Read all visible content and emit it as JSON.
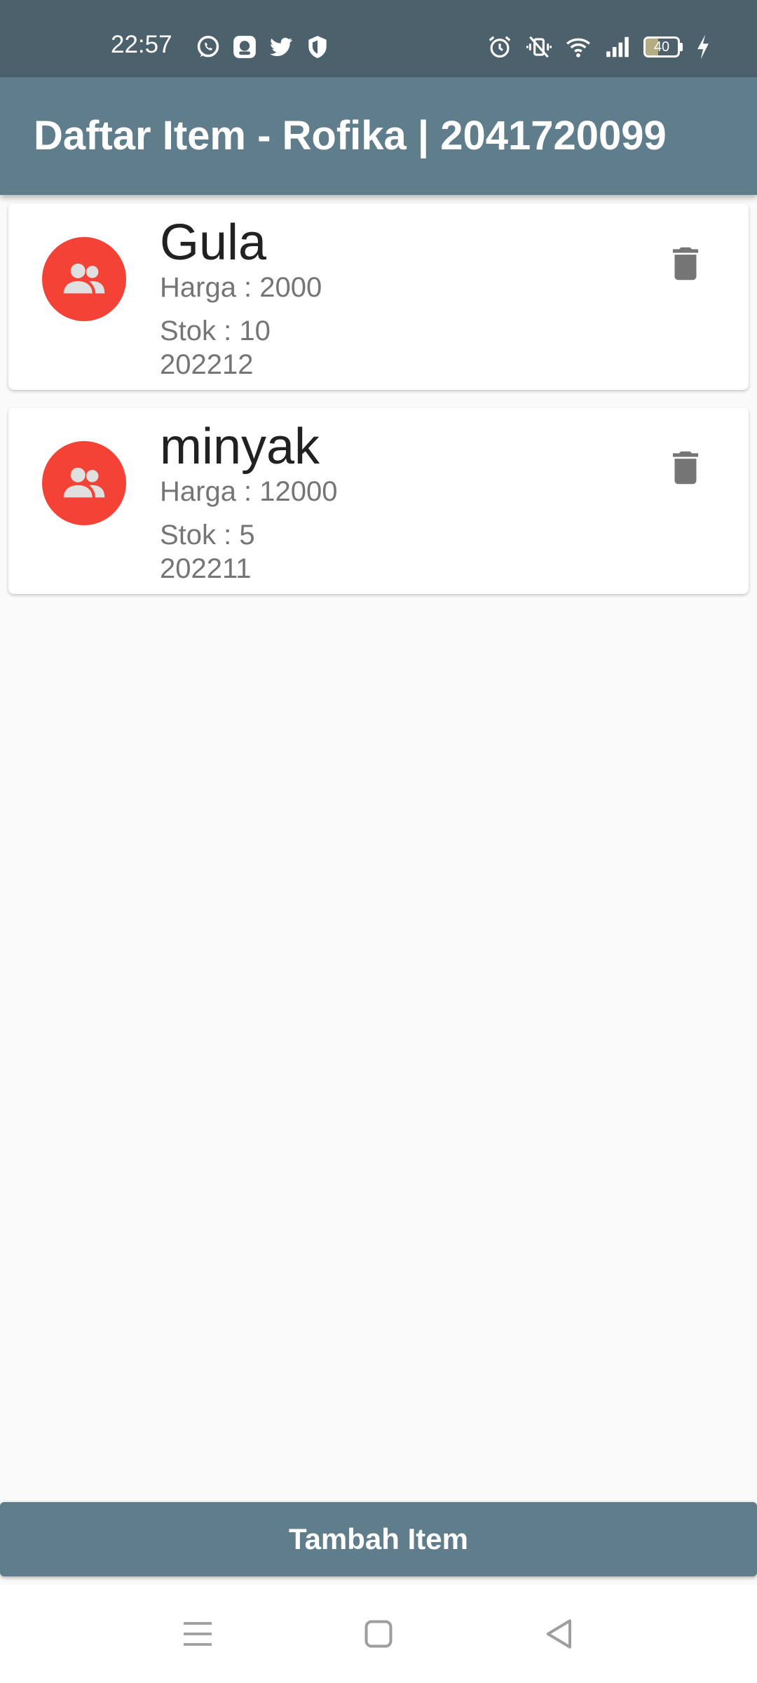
{
  "status_bar": {
    "time": "22:57",
    "left_icons": [
      "whatsapp-icon",
      "signal-app-icon",
      "twitter-icon",
      "shield-icon"
    ],
    "right_icons": [
      "alarm-icon",
      "vibrate-off-icon",
      "wifi-icon",
      "cell-signal-icon"
    ],
    "battery_level": "40",
    "battery_fraction": 0.4,
    "charging_icon": "bolt-icon"
  },
  "app_bar": {
    "title": "Daftar Item - Rofika | 2041720099"
  },
  "items": [
    {
      "name": "Gula",
      "harga": "Harga : 2000",
      "stok": "Stok : 10",
      "kode": "202212",
      "avatar_icon": "people-icon",
      "action_icon": "delete-icon"
    },
    {
      "name": "minyak",
      "harga": "Harga : 12000",
      "stok": "Stok : 5",
      "kode": "202211",
      "avatar_icon": "people-icon",
      "action_icon": "delete-icon"
    }
  ],
  "footer": {
    "add_button_label": "Tambah Item"
  },
  "nav_bar": {
    "icons": [
      "menu-icon",
      "home-square-icon",
      "back-triangle-icon"
    ]
  },
  "colors": {
    "status_bar": "#4c616c",
    "app_bar": "#607d8b",
    "avatar": "#f44336",
    "background": "#fafafa",
    "delete_icon": "#757575"
  }
}
